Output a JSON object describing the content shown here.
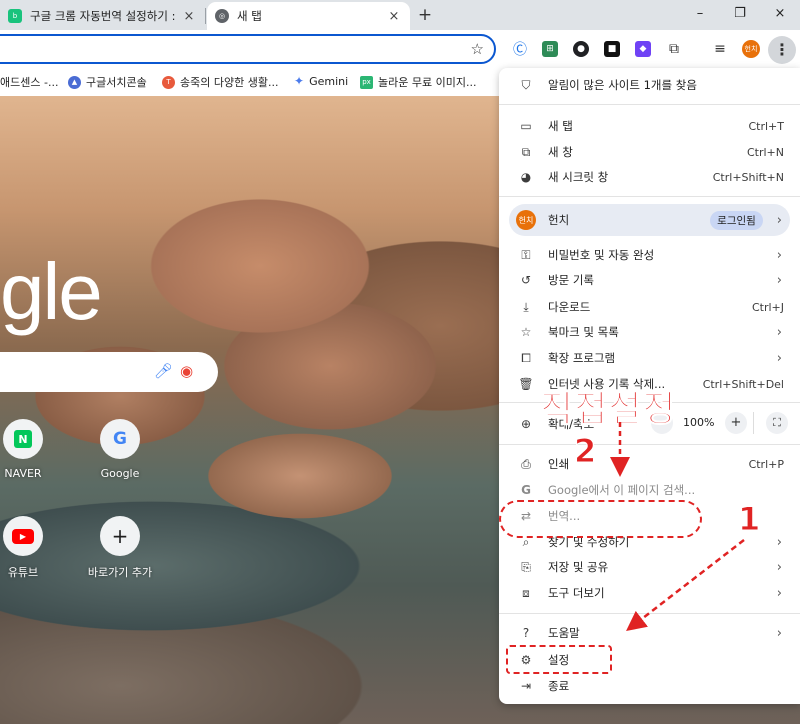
{
  "tabs": [
    {
      "title": "구글 크롬 자동번역 설정하기 :",
      "favicon": "blog-icon",
      "active": false
    },
    {
      "title": "새 탭",
      "favicon": "chrome-icon",
      "active": true
    }
  ],
  "tab_close": "×",
  "new_tab": "+",
  "window_controls": {
    "minimize": "–",
    "maximize": "❐",
    "close": "×"
  },
  "bookmarks": [
    {
      "label": "애드센스 -...",
      "icon": "adsense-icon"
    },
    {
      "label": "구글서치콘솔",
      "icon": "search-console-icon"
    },
    {
      "label": "송죽의 다양한 생활...",
      "icon": "tistory-icon"
    },
    {
      "label": "Gemini",
      "icon": "gemini-icon"
    },
    {
      "label": "놀라운 무료 이미지...",
      "icon": "px-icon"
    }
  ],
  "extensions": [
    {
      "name": "c-extension-icon",
      "glyph": "Ⓒ",
      "color": "#1a73e8"
    },
    {
      "name": "translate-extension-icon",
      "glyph": "⊞",
      "color": "#2e8b57"
    },
    {
      "name": "globe-extension-icon",
      "glyph": "●",
      "color": "#202124"
    },
    {
      "name": "square-extension-icon",
      "glyph": "■",
      "color": "#111111"
    },
    {
      "name": "purple-extension-icon",
      "glyph": "◆",
      "color": "#6f42f5"
    },
    {
      "name": "puzzle-icon",
      "glyph": "⧉",
      "color": "#ffffff"
    },
    {
      "name": "media-icon",
      "glyph": "≡",
      "color": "#ffffff"
    }
  ],
  "profile_avatar": "헌치",
  "ntp": {
    "logo_partial": "gle",
    "shortcuts": [
      {
        "label": "NAVER",
        "glyph": "N",
        "color": "#03c75a"
      },
      {
        "label": "Google",
        "glyph": "G",
        "color": "#4285f4"
      },
      {
        "label": "유튜브",
        "glyph": "▶",
        "color": "#ff0000"
      },
      {
        "label": "바로가기 추가",
        "glyph": "+",
        "color": "#1f1f1f"
      }
    ]
  },
  "menu": {
    "notification": "알림이 많은 사이트 1개를 찾음",
    "new_tab": {
      "label": "새 탭",
      "shortcut": "Ctrl+T"
    },
    "new_window": {
      "label": "새 창",
      "shortcut": "Ctrl+N"
    },
    "incognito": {
      "label": "새 시크릿 창",
      "shortcut": "Ctrl+Shift+N"
    },
    "profile": {
      "name": "헌치",
      "avatar": "헌치",
      "status": "로그인됨"
    },
    "passwords": {
      "label": "비밀번호 및 자동 완성"
    },
    "history": {
      "label": "방문 기록"
    },
    "downloads": {
      "label": "다운로드",
      "shortcut": "Ctrl+J"
    },
    "bookmarks": {
      "label": "북마크 및 목록"
    },
    "extensions": {
      "label": "확장 프로그램"
    },
    "clear_data": {
      "label": "인터넷 사용 기록 삭제...",
      "shortcut": "Ctrl+Shift+Del"
    },
    "zoom": {
      "label": "확대/축소",
      "value": "100%",
      "minus": "−",
      "plus": "+"
    },
    "print": {
      "label": "인쇄",
      "shortcut": "Ctrl+P"
    },
    "search_page": {
      "label": "Google에서 이 페이지 검색..."
    },
    "translate": {
      "label": "번역..."
    },
    "find_edit": {
      "label": "찾기 및 수정하기"
    },
    "save_share": {
      "label": "저장 및 공유"
    },
    "more_tools": {
      "label": "도구 더보기"
    },
    "help": {
      "label": "도움말"
    },
    "settings": {
      "label": "설정"
    },
    "exit": {
      "label": "종료"
    }
  },
  "annotations": {
    "title": "직접설정",
    "step1": "1",
    "step2": "2",
    "color": "#e02323"
  }
}
